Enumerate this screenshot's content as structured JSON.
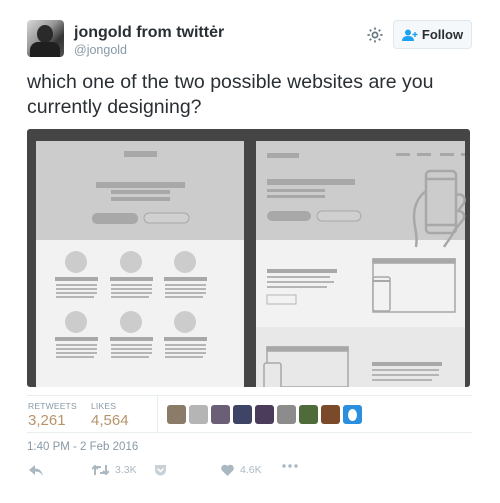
{
  "user": {
    "display_name": "jongold from twittėr",
    "handle": "@jongold",
    "avatar_icon": "user-avatar"
  },
  "header": {
    "settings_icon": "gear-icon",
    "follow_label": "Follow",
    "follow_icon": "add-user-icon"
  },
  "tweet": {
    "text": "which one of the two possible websites are you currently designing?"
  },
  "media": {
    "description": "Two website wireframe mockups side by side",
    "colors": {
      "frame": "#454545",
      "hero_bg": "#cccccc",
      "section_bg": "#f2f2f2",
      "section_alt_bg": "#e8e8e8",
      "element": "#a8a8a8"
    }
  },
  "stats": {
    "retweets_label": "RETWEETS",
    "retweets_value": "3,261",
    "likes_label": "LIKES",
    "likes_value": "4,564",
    "likers": [
      {
        "name": "liker-1",
        "color": "#8a7c68"
      },
      {
        "name": "liker-2",
        "color": "#b5b5b5"
      },
      {
        "name": "liker-3",
        "color": "#6b5f78"
      },
      {
        "name": "liker-4",
        "color": "#3d4466"
      },
      {
        "name": "liker-5",
        "color": "#4a3c5a"
      },
      {
        "name": "liker-6",
        "color": "#8c8c8c"
      },
      {
        "name": "liker-7",
        "color": "#4f6b3a"
      },
      {
        "name": "liker-8",
        "color": "#7a4a2a"
      },
      {
        "name": "liker-9-default-egg",
        "color": "#2b8fe0"
      }
    ]
  },
  "timestamp": "1:40 PM - 2 Feb 2016",
  "actions": {
    "reply_icon": "reply-icon",
    "retweet_icon": "retweet-icon",
    "retweet_count": "3.3K",
    "pocket_icon": "pocket-icon",
    "like_icon": "heart-icon",
    "like_count": "4.6K",
    "more_icon": "more-icon"
  }
}
